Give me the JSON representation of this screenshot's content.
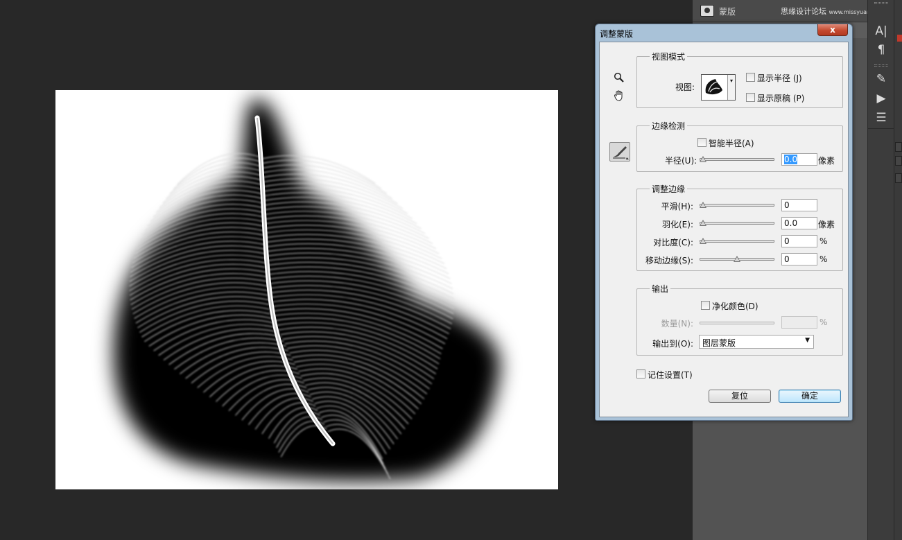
{
  "panel": {
    "layer_label": "蒙版",
    "watermark": "思缘设计论坛",
    "watermark_url": "www.missyuan.com"
  },
  "tools_right": [
    {
      "icon": "type-tool-icon",
      "glyph": "A|"
    },
    {
      "icon": "paragraph-icon",
      "glyph": "¶"
    },
    {
      "icon": "brushes-icon",
      "glyph": "✎"
    },
    {
      "icon": "play-action-icon",
      "glyph": "▶"
    },
    {
      "icon": "adjust-sliders-icon",
      "glyph": "☰"
    }
  ],
  "dialog": {
    "title": "调整蒙版",
    "close_glyph": "x",
    "view_mode": {
      "legend": "视图模式",
      "view_label": "视图:",
      "show_radius": "显示半径 (J)",
      "show_original": "显示原稿 (P)"
    },
    "edge_detection": {
      "legend": "边缘检测",
      "smart_radius": "智能半径(A)",
      "radius_label": "半径(U):",
      "radius_value": "0.0",
      "radius_unit": "像素",
      "radius_level": 0
    },
    "adjust_edge": {
      "legend": "调整边缘",
      "rows": [
        {
          "label": "平滑(H):",
          "value": "0",
          "unit": "",
          "level": 0
        },
        {
          "label": "羽化(E):",
          "value": "0.0",
          "unit": "像素",
          "level": 0
        },
        {
          "label": "对比度(C):",
          "value": "0",
          "unit": "%",
          "level": 0
        },
        {
          "label": "移动边缘(S):",
          "value": "0",
          "unit": "%",
          "level": 0.5
        }
      ]
    },
    "output": {
      "legend": "输出",
      "decontaminate": "净化颜色(D)",
      "amount_label": "数量(N):",
      "amount_unit": "%",
      "output_to_label": "输出到(O):",
      "output_to_value": "图层蒙版"
    },
    "remember": "记住设置(T)",
    "reset_button": "复位",
    "ok_button": "确定"
  }
}
